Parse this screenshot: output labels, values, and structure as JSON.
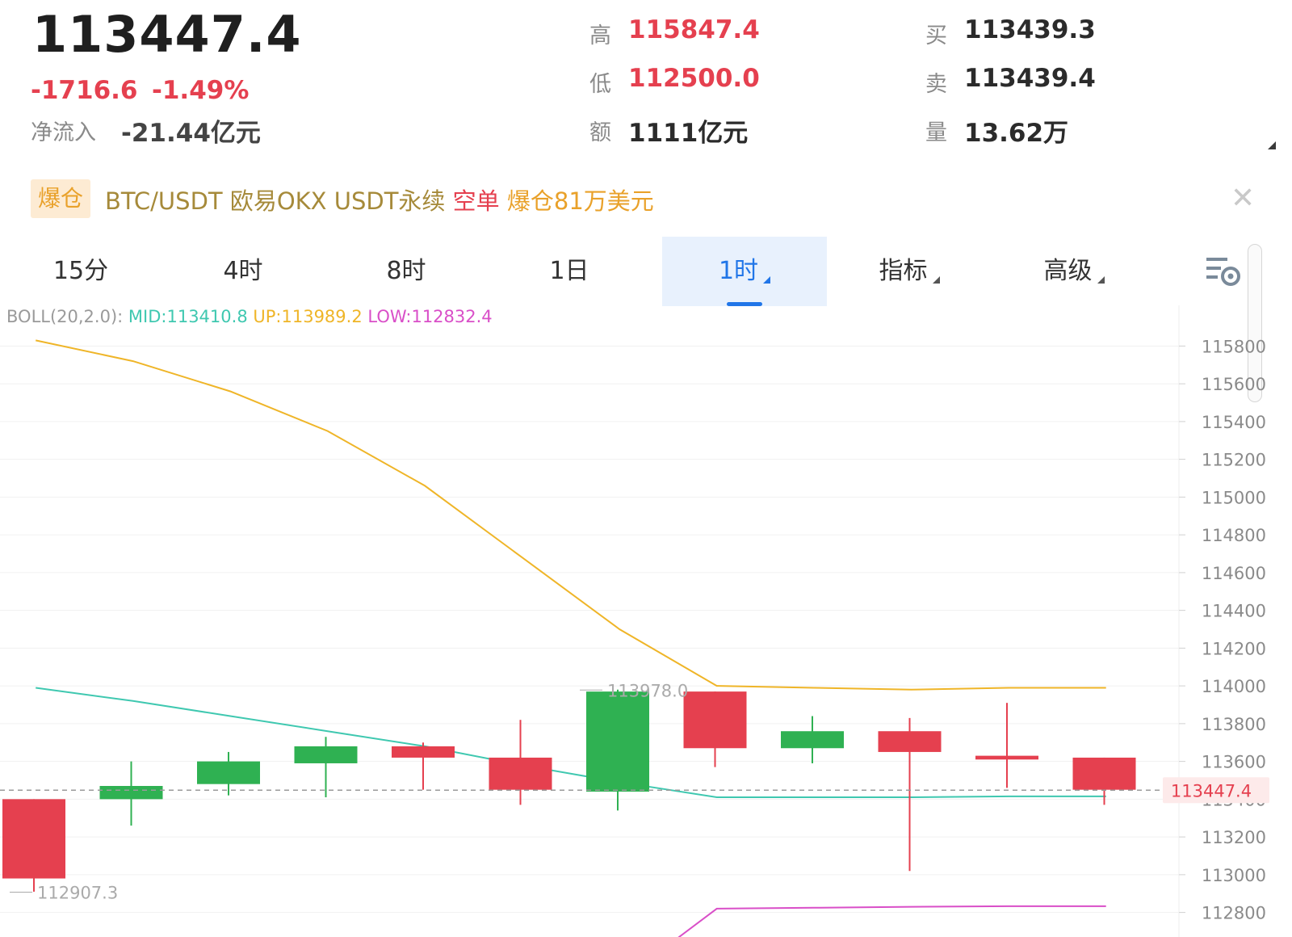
{
  "quote": {
    "price": "113447.4",
    "change": "-1716.6",
    "change_pct": "-1.49%",
    "net_inflow_label": "净流入",
    "net_inflow_value": "-21.44亿元",
    "high_label": "高",
    "high_value": "115847.4",
    "low_label": "低",
    "low_value": "112500.0",
    "amount_label": "额",
    "amount_value": "1111亿元",
    "buy_label": "买",
    "buy_value": "113439.3",
    "sell_label": "卖",
    "sell_value": "113439.4",
    "volume_label": "量",
    "volume_value": "13.62万"
  },
  "banner": {
    "tag": "爆仓",
    "pair": "BTC/USDT 欧易OKX USDT永续",
    "side": "空单",
    "amount": "爆仓81万美元",
    "close_icon": "close-icon"
  },
  "tabs": [
    {
      "label": "15分",
      "active": false
    },
    {
      "label": "4时",
      "active": false
    },
    {
      "label": "8时",
      "active": false
    },
    {
      "label": "1日",
      "active": false
    },
    {
      "label": "1时",
      "active": true
    },
    {
      "label": "指标",
      "active": false
    },
    {
      "label": "高级",
      "active": false
    }
  ],
  "boll": {
    "name": "BOLL(20,2.0):",
    "mid": "MID:113410.8",
    "up": "UP:113989.2",
    "low": "LOW:112832.4"
  },
  "colors": {
    "up_candle": "#2fb152",
    "down_candle": "#e5404f",
    "mid_line": "#3fc8b0",
    "upper_line": "#efb528",
    "lower_line": "#d94fc8",
    "accent": "#2176e8"
  },
  "chart_data": {
    "type": "candlestick",
    "y_ticks": [
      "115800",
      "115600",
      "115400",
      "115200",
      "115000",
      "114800",
      "114600",
      "114400",
      "114200",
      "114000",
      "113800",
      "113600",
      "113400",
      "113200",
      "113000",
      "112800"
    ],
    "ylim": [
      112670,
      115930
    ],
    "current_price_label": "113447.4",
    "high_marker_label": "113978.0",
    "low_marker_label": "112907.3",
    "candles": [
      {
        "open": 113400,
        "close": 112980,
        "high": 113400,
        "low": 112910
      },
      {
        "open": 113400,
        "close": 113470,
        "high": 113600,
        "low": 113260
      },
      {
        "open": 113480,
        "close": 113600,
        "high": 113650,
        "low": 113420
      },
      {
        "open": 113590,
        "close": 113680,
        "high": 113730,
        "low": 113410
      },
      {
        "open": 113680,
        "close": 113620,
        "high": 113700,
        "low": 113450
      },
      {
        "open": 113620,
        "close": 113450,
        "high": 113820,
        "low": 113370
      },
      {
        "open": 113440,
        "close": 113970,
        "high": 113980,
        "low": 113340
      },
      {
        "open": 113970,
        "close": 113670,
        "high": 113970,
        "low": 113570
      },
      {
        "open": 113670,
        "close": 113760,
        "high": 113840,
        "low": 113590
      },
      {
        "open": 113760,
        "close": 113650,
        "high": 113830,
        "low": 113020
      },
      {
        "open": 113630,
        "close": 113610,
        "high": 113910,
        "low": 113460
      },
      {
        "open": 113620,
        "close": 113450,
        "high": 113620,
        "low": 113370
      }
    ],
    "boll_upper": [
      115830,
      115720,
      115560,
      115350,
      115060,
      114680,
      114300,
      114000,
      113990,
      113980,
      113990,
      113990
    ],
    "boll_mid": [
      113990,
      113920,
      113840,
      113760,
      113680,
      113580,
      113490,
      113410,
      113410,
      113410,
      113415,
      113415
    ],
    "boll_lower": [
      null,
      null,
      null,
      null,
      null,
      null,
      null,
      112820,
      112825,
      112830,
      112833,
      112833
    ]
  }
}
